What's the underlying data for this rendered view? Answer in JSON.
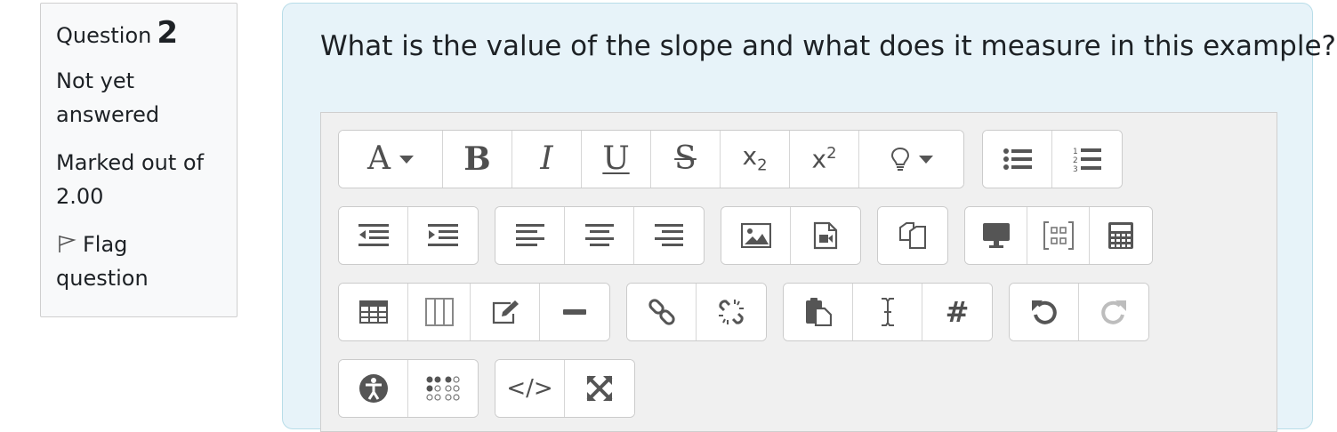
{
  "info": {
    "question_label": "Question",
    "question_number": "2",
    "status": "Not yet answered",
    "grade": "Marked out of 2.00",
    "flag_label": "Flag question"
  },
  "question": {
    "text": "What is the value of the slope and what does it measure in this example?"
  },
  "toolbar": {
    "font_style_glyph": "A",
    "bold_glyph": "B",
    "italic_glyph": "I",
    "underline_glyph": "U",
    "strike_glyph": "S",
    "subscript_base": "x",
    "subscript_sub": "2",
    "superscript_base": "x",
    "superscript_sup": "2",
    "special_char_glyph": "#",
    "html_glyph": "</>",
    "icons": [
      "font-style-icon",
      "bold-icon",
      "italic-icon",
      "underline-icon",
      "strikethrough-icon",
      "subscript-icon",
      "superscript-icon",
      "lightbulb-icon",
      "bullet-list-icon",
      "numbered-list-icon",
      "outdent-icon",
      "indent-icon",
      "align-left-icon",
      "align-center-icon",
      "align-right-icon",
      "image-icon",
      "media-icon",
      "manage-files-icon",
      "screen-recorder-icon",
      "equation-icon",
      "calculator-icon",
      "table-icon",
      "columns-icon",
      "edit-icon",
      "horizontal-rule-icon",
      "link-icon",
      "unlink-icon",
      "paste-icon",
      "text-cursor-icon",
      "hash-icon",
      "undo-icon",
      "redo-icon",
      "accessibility-icon",
      "braille-icon",
      "html-code-icon",
      "fullscreen-icon"
    ]
  }
}
